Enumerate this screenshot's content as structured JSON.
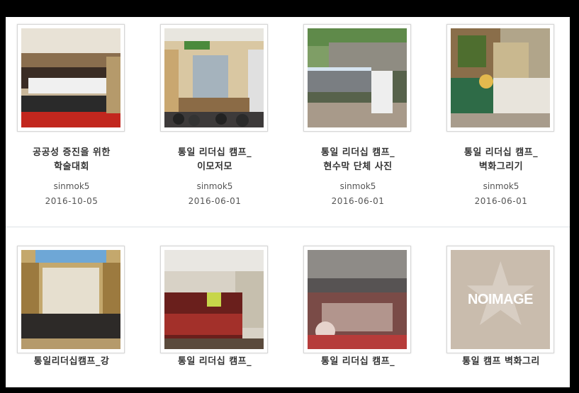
{
  "gallery": {
    "row1": [
      {
        "title_line1": "공공성 증진을 위한",
        "title_line2": "학술대회",
        "author": "sinmok5",
        "date": "2016-10-05"
      },
      {
        "title_line1": "통일 리더십 캠프_",
        "title_line2": "이모저모",
        "author": "sinmok5",
        "date": "2016-06-01"
      },
      {
        "title_line1": "통일 리더십 캠프_",
        "title_line2": "현수막 단체 사진",
        "author": "sinmok5",
        "date": "2016-06-01"
      },
      {
        "title_line1": "통일 리더십 캠프_",
        "title_line2": "벽화그리기",
        "author": "sinmok5",
        "date": "2016-06-01"
      }
    ],
    "row2": [
      {
        "title_line1": "통일리더십캠프_강"
      },
      {
        "title_line1": "통일 리더십 캠프_"
      },
      {
        "title_line1": "통일 리더십 캠프_"
      },
      {
        "title_line1": "통일 캠프 벽화그리"
      }
    ],
    "noimage_label": "NOIMAGE"
  }
}
